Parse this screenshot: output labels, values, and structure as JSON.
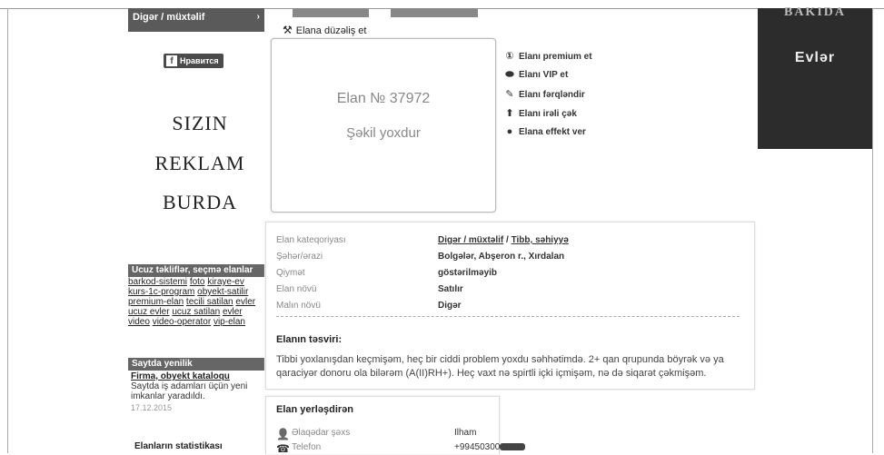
{
  "sidebar": {
    "category_bar": "Digər / müxtəlif",
    "category_arrow": "›",
    "fb_like": "Нравится",
    "ad_lines": [
      "SIZIN",
      "REKLAM",
      "BURDA"
    ],
    "offers_title": "Ucuz təkliflər, seçmə elanlar",
    "tags": [
      "barkod-sistemi",
      "foto",
      "kiraye-ev",
      "kurs-1c-program",
      "obyekt-satilir",
      "premium-elan",
      "tecili satilan",
      "evler",
      "ucuz evler",
      "ucuz satilan",
      "evler",
      "video",
      "video-operator",
      "vip-elan"
    ],
    "news_box_title": "Saytda yenilik",
    "news_title": "Firma, obyekt kataloqu",
    "news_text": "Saytda iş adamları üçün yeni imkanlar yaradıldı.",
    "news_date": "17.12.2015",
    "stats_title": "Elanların statistikası"
  },
  "main": {
    "edit_link": "Elana düzəliş et",
    "image_box": {
      "number": "Elan № 37972",
      "no_image": "Şəkil yoxdur"
    },
    "actions": [
      {
        "icon": "premium-icon",
        "glyph": "①",
        "label": "Elanı premium et"
      },
      {
        "icon": "vip-icon",
        "glyph": "⬬",
        "label": "Elanı VIP et"
      },
      {
        "icon": "pencil-icon",
        "glyph": "✎",
        "label": "Elanı fərqləndir"
      },
      {
        "icon": "arrow-up-icon",
        "glyph": "⬆",
        "label": "Elanı irəli çək"
      },
      {
        "icon": "effect-icon",
        "glyph": "●",
        "label": "Elana effekt ver"
      }
    ],
    "details": {
      "category_label": "Elan kateqoriyası",
      "category_value_1": "Digər / müxtəlif",
      "category_sep": " / ",
      "category_value_2": "Tibb, səhiyyə",
      "city_label": "Şəhər/ərazi",
      "city_value": "Bolgələr, Abşeron r., Xırdalan",
      "price_label": "Qiymət",
      "price_value": "göstərilməyib",
      "type_label": "Elan növü",
      "type_value": "Satılır",
      "goods_label": "Malın növü",
      "goods_value": "Digər",
      "description_title": "Elanın təsviri:",
      "description_text": "Tibbi yoxlanışdan keçmişəm, heç bir ciddi problem yoxdu səhhətimdə. 2+ qan qrupunda böyrək və ya qaraciyər donoru ola bilərəm (A(II)RH+). Heç vaxt nə spirtli içki içmişəm, nə də siqarət çəkmişəm."
    },
    "poster": {
      "title": "Elan yerləşdirən",
      "contact_label": "Əlaqədar şəxs",
      "contact_value": "Ilham",
      "phone_label": "Telefon",
      "phone_value": "+99450300"
    }
  },
  "banner": {
    "top_text": "BAKIDA",
    "brand": "Evlər"
  }
}
